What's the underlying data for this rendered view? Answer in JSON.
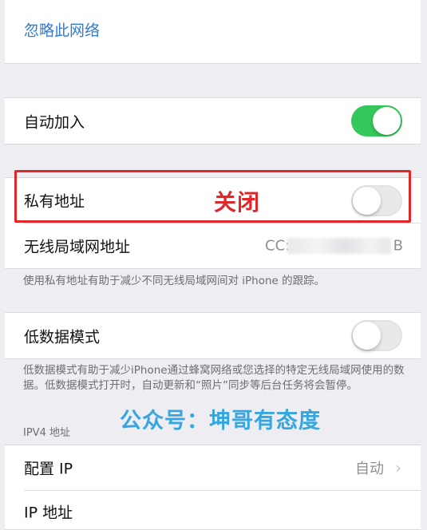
{
  "forget_network": "忽略此网络",
  "auto_join": {
    "label": "自动加入",
    "state": "on",
    "color": "#34c759"
  },
  "private_address": {
    "label": "私有地址",
    "state": "off"
  },
  "annotation_label": "关闭",
  "wlan_address": {
    "label": "无线局域网地址",
    "value_prefix": "CC:",
    "value_suffix": "B"
  },
  "private_note": "使用私有地址有助于减少不同无线局域网间对 iPhone 的跟踪。",
  "low_data_mode": {
    "label": "低数据模式",
    "state": "off"
  },
  "low_data_note": "低数据模式有助于减少iPhone通过蜂窝网络或您选择的特定无线局域网使用的数据。低数据模式打开时，自动更新和“照片”同步等后台任务将会暂停。",
  "watermark": "公众号：坤哥有态度",
  "ipv4_header": "IPV4 地址",
  "configure_ip": {
    "label": "配置 IP",
    "value": "自动"
  },
  "ip_address": {
    "label": "IP 地址"
  }
}
